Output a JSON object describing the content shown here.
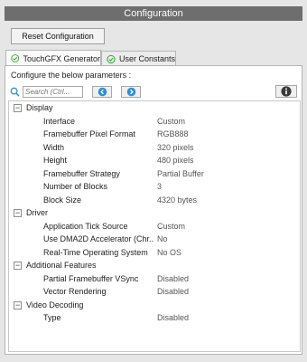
{
  "window": {
    "title": "Configuration"
  },
  "toolbar": {
    "reset_label": "Reset Configuration"
  },
  "tabs": [
    {
      "label": "TouchGFX Generator",
      "active": true,
      "icon": "check-circle-icon"
    },
    {
      "label": "User Constants",
      "active": false,
      "icon": "check-circle-icon"
    }
  ],
  "panel": {
    "description": "Configure the below parameters :",
    "search": {
      "placeholder": "Search (Ctrl..."
    }
  },
  "groups": [
    {
      "name": "Display",
      "expanded": true,
      "params": [
        {
          "name": "Interface",
          "value": "Custom"
        },
        {
          "name": "Framebuffer Pixel Format",
          "value": "RGB888"
        },
        {
          "name": "Width",
          "value": "320 pixels"
        },
        {
          "name": "Height",
          "value": "480 pixels"
        },
        {
          "name": "Framebuffer Strategy",
          "value": "Partial Buffer"
        },
        {
          "name": "Number of Blocks",
          "value": "3"
        },
        {
          "name": "Block Size",
          "value": "4320 bytes"
        }
      ]
    },
    {
      "name": "Driver",
      "expanded": true,
      "params": [
        {
          "name": "Application Tick Source",
          "value": "Custom"
        },
        {
          "name": "Use DMA2D Accelerator (Chr...",
          "value": "No"
        },
        {
          "name": "Real-Time Operating System",
          "value": "No OS"
        }
      ]
    },
    {
      "name": "Additional Features",
      "expanded": true,
      "params": [
        {
          "name": "Partial Framebuffer VSync",
          "value": "Disabled"
        },
        {
          "name": "Vector Rendering",
          "value": "Disabled"
        }
      ]
    },
    {
      "name": "Video Decoding",
      "expanded": true,
      "params": [
        {
          "name": "Type",
          "value": "Disabled"
        }
      ]
    }
  ],
  "colors": {
    "accent": "#2e8fd8",
    "check": "#3aa534",
    "titlebar": "#6e6e6e"
  }
}
